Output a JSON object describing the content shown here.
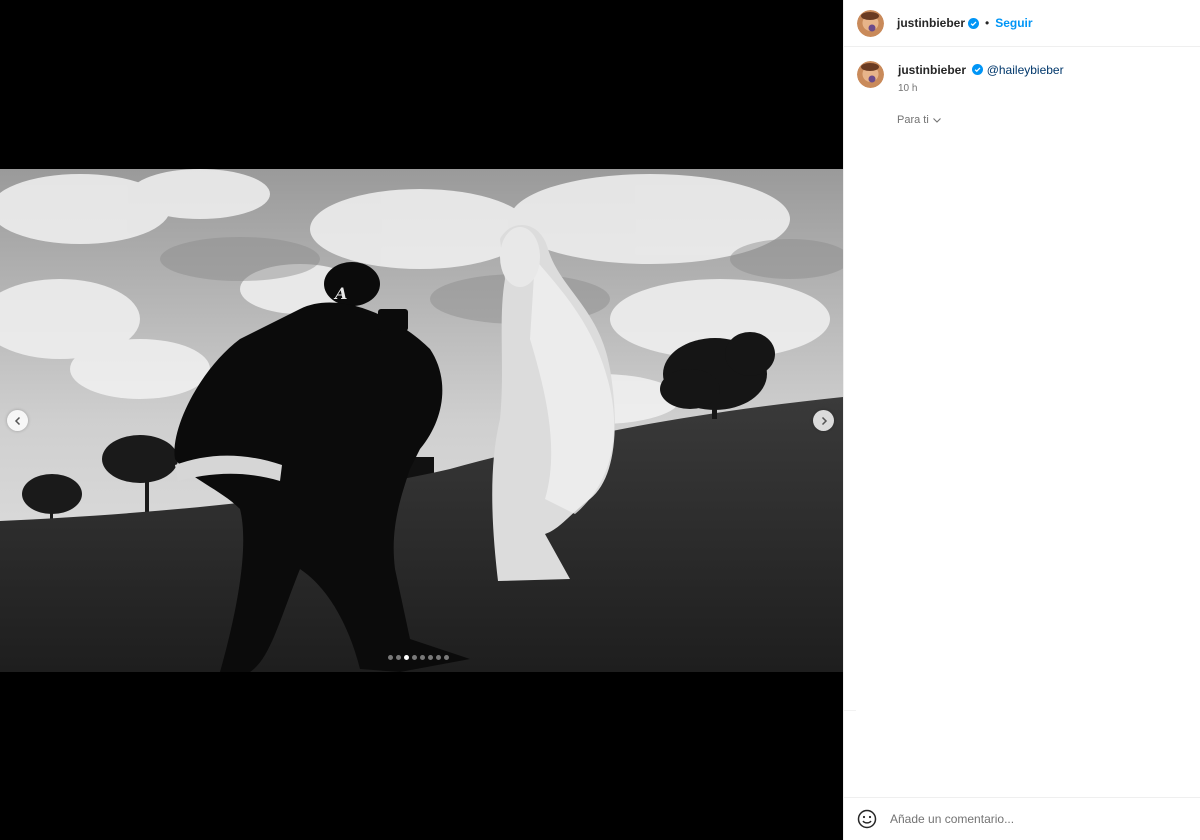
{
  "post": {
    "author": "justinbieber",
    "follow_label": "Seguir",
    "separator": "•",
    "media": {
      "total_slides": 8,
      "active_slide": 3
    }
  },
  "caption": {
    "author": "justinbieber",
    "mention": "@haileybieber",
    "time": "10 h"
  },
  "comments": {
    "sort_label": "Para ti"
  },
  "comment_box": {
    "placeholder": "Añade un comentario..."
  },
  "icons": {
    "verified": "verified-badge-icon",
    "prev": "chevron-left-icon",
    "next": "chevron-right-icon",
    "sort": "chevron-down-icon",
    "emoji": "emoji-icon"
  },
  "colors": {
    "link": "#0095f6",
    "mention": "#00376b",
    "verified": "#0095f6",
    "muted": "#737373"
  }
}
